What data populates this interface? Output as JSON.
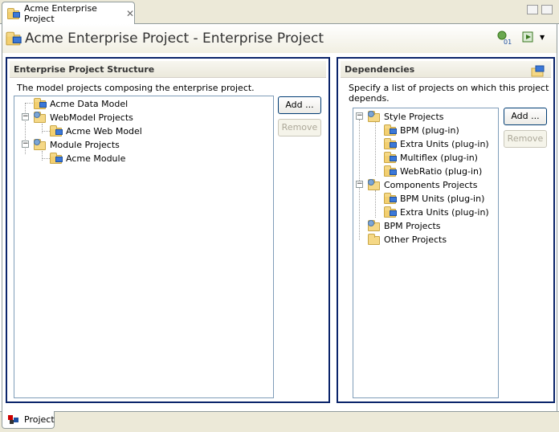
{
  "editor_tab": {
    "title": "Acme Enterprise Project",
    "close_glyph": "✕"
  },
  "header": {
    "title": "Acme Enterprise Project - Enterprise Project"
  },
  "structure": {
    "title": "Enterprise Project Structure",
    "description": "The model projects composing the enterprise project.",
    "tree": [
      {
        "label": "Acme Data Model",
        "icon": "project-icon"
      },
      {
        "label": "WebModel Projects",
        "icon": "folder-icon",
        "expanded": true
      },
      {
        "label": "Acme Web Model",
        "icon": "project-icon"
      },
      {
        "label": "Module Projects",
        "icon": "folder-icon",
        "expanded": true
      },
      {
        "label": "Acme Module",
        "icon": "project-icon"
      }
    ],
    "add_label": "Add ...",
    "remove_label": "Remove"
  },
  "dependencies": {
    "title": "Dependencies",
    "description_line1": "Specify a list of projects on which this project",
    "description_line2": "depends.",
    "tree": [
      {
        "label": "Style Projects",
        "icon": "folder-icon"
      },
      {
        "label": "BPM  (plug-in)",
        "icon": "project-icon"
      },
      {
        "label": "Extra Units  (plug-in)",
        "icon": "project-icon"
      },
      {
        "label": "Multiflex  (plug-in)",
        "icon": "project-icon"
      },
      {
        "label": "WebRatio  (plug-in)",
        "icon": "project-icon"
      },
      {
        "label": "Components Projects",
        "icon": "folder-icon"
      },
      {
        "label": "BPM Units  (plug-in)",
        "icon": "project-icon"
      },
      {
        "label": "Extra Units  (plug-in)",
        "icon": "project-icon"
      },
      {
        "label": "BPM Projects",
        "icon": "folder-icon"
      },
      {
        "label": "Other Projects",
        "icon": "folder-icon"
      }
    ],
    "add_label": "Add ...",
    "remove_label": "Remove"
  },
  "bottom_tab": {
    "label": "Project"
  },
  "colors": {
    "section_border": "#0a246a",
    "button_border": "#003c74",
    "tree_border": "#7f9db9"
  }
}
